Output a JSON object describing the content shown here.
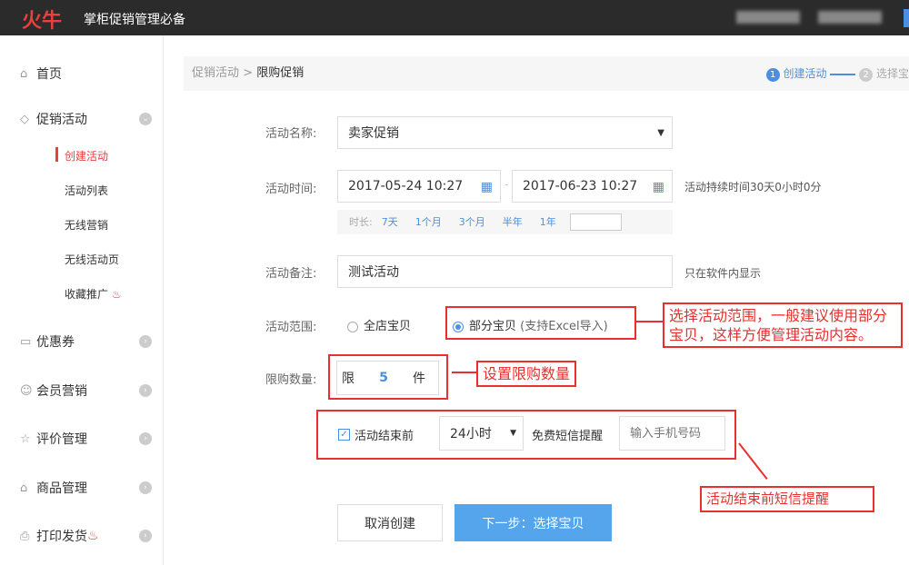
{
  "header": {
    "logo": "火牛",
    "slogan": "掌柜促销管理必备"
  },
  "sidebar": {
    "items": [
      {
        "label": "首页",
        "icon": "home-icon"
      },
      {
        "label": "促销活动",
        "icon": "tag-icon",
        "sub": [
          "创建活动",
          "活动列表",
          "无线营销",
          "无线活动页",
          "收藏推广"
        ]
      },
      {
        "label": "优惠券",
        "icon": "coupon-icon"
      },
      {
        "label": "会员营销",
        "icon": "user-icon"
      },
      {
        "label": "评价管理",
        "icon": "review-icon"
      },
      {
        "label": "商品管理",
        "icon": "shop-icon"
      },
      {
        "label": "打印发货",
        "icon": "print-icon"
      }
    ]
  },
  "breadcrumb": {
    "parent": "促销活动",
    "sep": ">",
    "current": "限购促销"
  },
  "steps": [
    {
      "num": "1",
      "label": "创建活动"
    },
    {
      "num": "2",
      "label": "选择宝"
    }
  ],
  "form": {
    "name_label": "活动名称:",
    "name_value": "卖家促销",
    "time_label": "活动时间:",
    "start": "2017-05-24 10:27",
    "dash": "-",
    "end": "2017-06-23 10:27",
    "duration": "活动持续时间30天0小时0分",
    "quick_label": "时长:",
    "quick": [
      "7天",
      "1个月",
      "3个月",
      "半年",
      "1年"
    ],
    "note_label": "活动备注:",
    "note_value": "测试活动",
    "note_hint": "只在软件内显示",
    "scope_label": "活动范围:",
    "scope_all": "全店宝贝",
    "scope_part": "部分宝贝",
    "scope_part_hint": "(支持Excel导入)",
    "limit_label": "限购数量:",
    "limit_prefix": "限",
    "limit_value": "5",
    "limit_suffix": "件",
    "remind_check": "活动结束前",
    "remind_time": "24小时",
    "remind_text": "免费短信提醒",
    "phone_placeholder": "输入手机号码",
    "cancel": "取消创建",
    "next": "下一步：选择宝贝"
  },
  "annotations": {
    "scope": "选择活动范围，一般建议使用部分宝贝，这样方便管理活动内容。",
    "limit": "设置限购数量",
    "sms": "活动结束前短信提醒"
  }
}
